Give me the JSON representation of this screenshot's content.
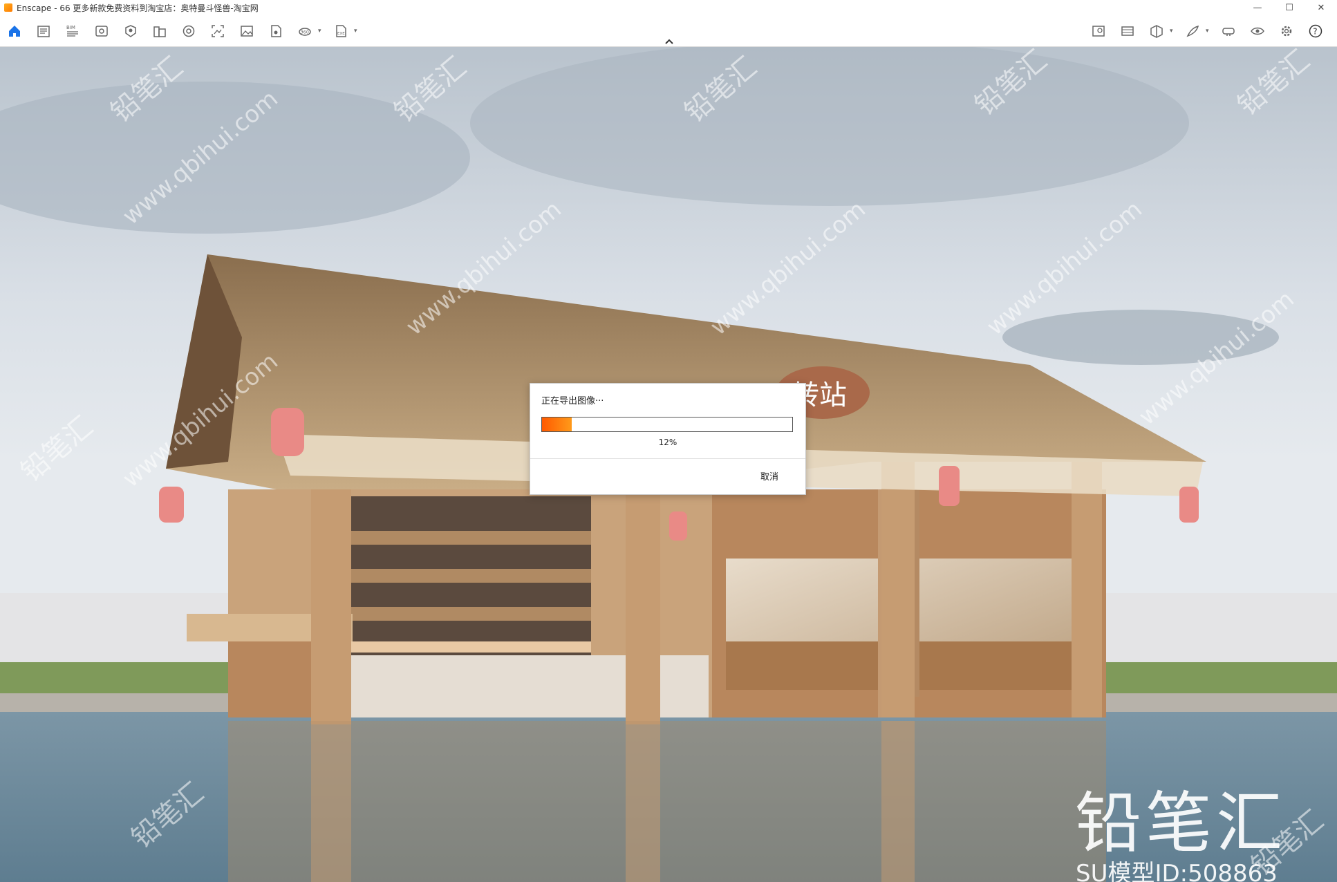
{
  "window": {
    "title": "Enscape - 66 更多新款免费资料到淘宝店：奥特曼斗怪兽-淘宝网",
    "controls": {
      "minimize": "—",
      "maximize": "☐",
      "close": "✕"
    }
  },
  "toolbar": {
    "left_icons": [
      "home-icon",
      "project-icon",
      "bim-icon",
      "view-icon",
      "asset-icon",
      "building-icon",
      "material-icon",
      "screenshot-icon",
      "image-icon",
      "export-icon",
      "panorama-icon",
      "exe-icon"
    ],
    "right_icons": [
      "map-icon",
      "capture-icon",
      "cube-icon",
      "feather-icon",
      "vr-icon",
      "visibility-icon",
      "settings-icon",
      "help-icon"
    ],
    "bim_label": "BIM",
    "panorama_label": "360",
    "exe_label": "EXE",
    "help_label": "?",
    "accent_color": "#1a73e8"
  },
  "dialog": {
    "title": "正在导出图像···",
    "progress": 0.12,
    "progress_label": "12%",
    "cancel_label": "取消"
  },
  "scene": {
    "sign_text": "转站",
    "watermark_big": "铅笔汇",
    "watermark_id": "SU模型ID:508863",
    "watermark_url": "www.qbihui.com",
    "watermark_cn": "铅笔汇"
  }
}
